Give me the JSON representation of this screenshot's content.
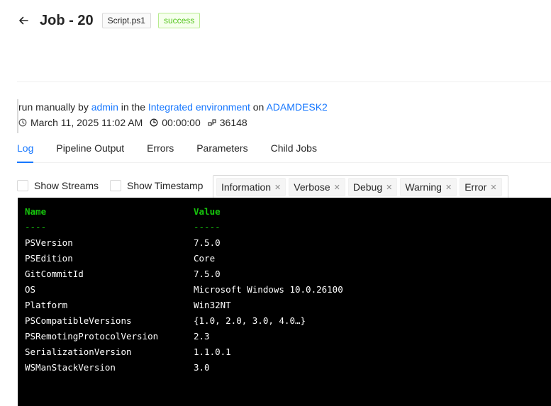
{
  "header": {
    "back_icon": "arrow-left-icon",
    "title": "Job - 20",
    "script_tag": "Script.ps1",
    "status_tag": "success",
    "status_color": "#52c41a"
  },
  "summary": {
    "run_prefix": "run manually by ",
    "user": "admin",
    "in_the": " in the ",
    "environment": "Integrated environment",
    "on": " on ",
    "host": "ADAMDESK2",
    "date": "March 11, 2025 11:02 AM",
    "duration": "00:00:00",
    "pid": "36148"
  },
  "tabs": [
    {
      "label": "Log",
      "active": true
    },
    {
      "label": "Pipeline Output",
      "active": false
    },
    {
      "label": "Errors",
      "active": false
    },
    {
      "label": "Parameters",
      "active": false
    },
    {
      "label": "Child Jobs",
      "active": false
    }
  ],
  "options": {
    "show_streams": "Show Streams",
    "show_timestamp": "Show Timestamp"
  },
  "levels": [
    "Information",
    "Verbose",
    "Debug",
    "Warning",
    "Error"
  ],
  "console": {
    "header": {
      "name": "Name",
      "value": "Value"
    },
    "separator": {
      "name": "----",
      "value": "-----"
    },
    "rows": [
      {
        "name": "PSVersion",
        "value": "7.5.0"
      },
      {
        "name": "PSEdition",
        "value": "Core"
      },
      {
        "name": "GitCommitId",
        "value": "7.5.0"
      },
      {
        "name": "OS",
        "value": "Microsoft Windows 10.0.26100"
      },
      {
        "name": "Platform",
        "value": "Win32NT"
      },
      {
        "name": "PSCompatibleVersions",
        "value": "{1.0, 2.0, 3.0, 4.0…}"
      },
      {
        "name": "PSRemotingProtocolVersion",
        "value": "2.3"
      },
      {
        "name": "SerializationVersion",
        "value": "1.1.0.1"
      },
      {
        "name": "WSManStackVersion",
        "value": "3.0"
      }
    ]
  }
}
